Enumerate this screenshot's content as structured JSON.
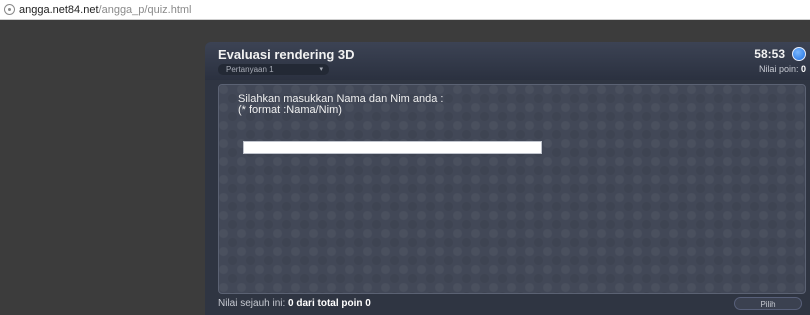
{
  "browser": {
    "url_host": "angga.net84.net",
    "url_path": "/angga_p/quiz.html"
  },
  "quiz": {
    "title": "Evaluasi rendering 3D",
    "question_selector": "Pertanyaan 1",
    "timer": "58:53",
    "score_label": "Nilai poin:",
    "score_value": "0",
    "prompt_line1": "Silahkan masukkan Nama dan Nim anda :",
    "prompt_line2": "(* format :Nama/Nim)",
    "answer_value": "",
    "footer_label": "Nilai sejauh ini:",
    "footer_value": "0 dari total poin 0",
    "submit_label": "Pilih"
  },
  "colors": {
    "timer_indicator": "#1e6fe0",
    "panel_background": "#424857"
  }
}
